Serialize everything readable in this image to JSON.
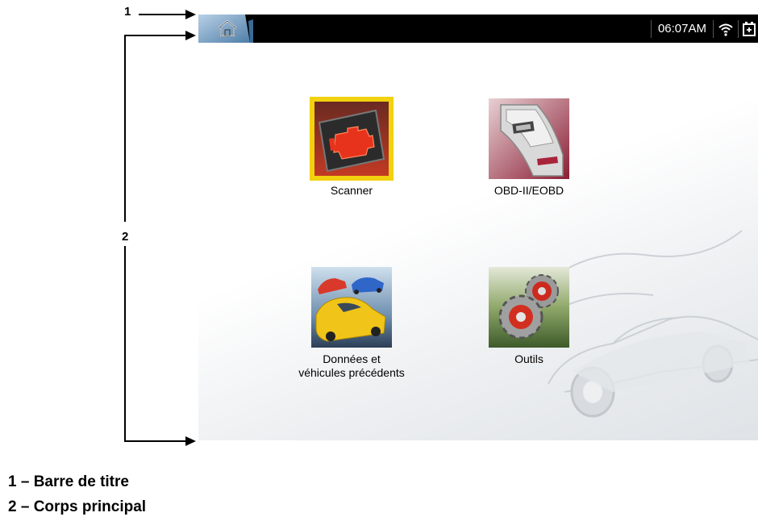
{
  "callouts": {
    "one": "1",
    "two": "2"
  },
  "legend": {
    "item1": "1 – Barre de titre",
    "item2": "2 – Corps principal"
  },
  "titlebar": {
    "home_icon": "home-icon",
    "time": "06:07AM",
    "wifi_icon": "wifi-icon",
    "battery_icon": "battery-icon"
  },
  "apps": [
    {
      "label": "Scanner",
      "icon": "engine-icon",
      "selected": true
    },
    {
      "label": "OBD-II/EOBD",
      "icon": "obd-connector-icon",
      "selected": false
    },
    {
      "label_line1": "Données et",
      "label_line2": "véhicules précédents",
      "icon": "cars-icon",
      "selected": false
    },
    {
      "label": "Outils",
      "icon": "gears-icon",
      "selected": false
    }
  ],
  "colors": {
    "titlebar": "#000000",
    "selection": "#f2d10f",
    "engine_red": "#e8331c",
    "obd_red": "#a8243a"
  }
}
